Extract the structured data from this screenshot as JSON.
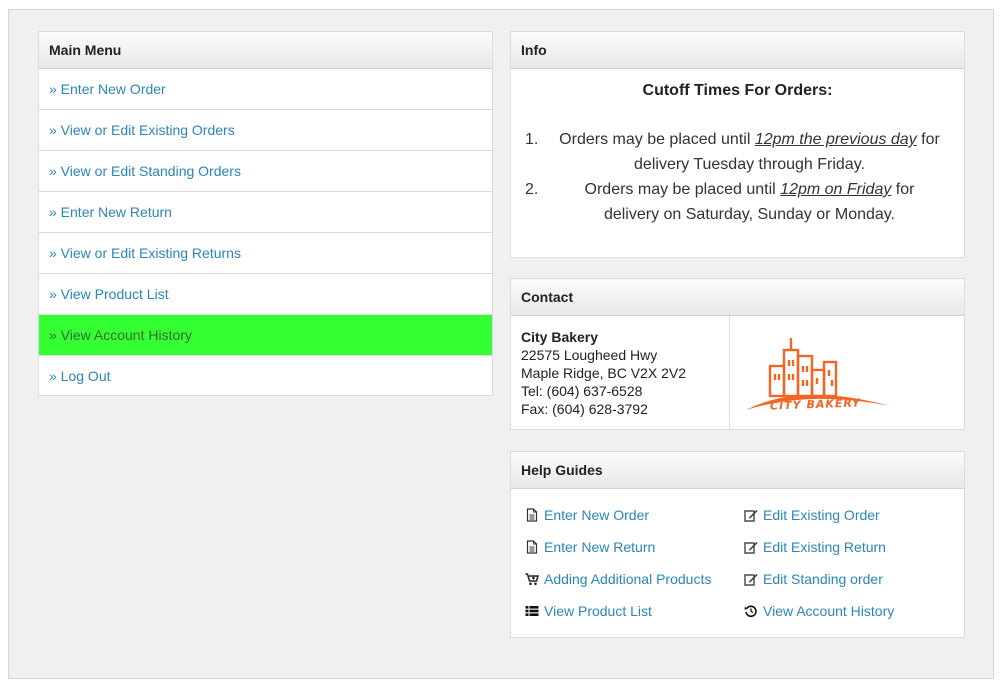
{
  "main_menu": {
    "title": "Main Menu",
    "items": [
      {
        "label": "» Enter New Order"
      },
      {
        "label": "» View or Edit Existing Orders"
      },
      {
        "label": "» View or Edit Standing Orders"
      },
      {
        "label": "» Enter New Return"
      },
      {
        "label": "» View or Edit Existing Returns"
      },
      {
        "label": "» View Product List"
      },
      {
        "label": "» View Account History",
        "active": true
      },
      {
        "label": "» Log Out"
      }
    ],
    "active_color": "#33ff33",
    "link_color": "#2a86b8"
  },
  "info": {
    "title": "Info",
    "heading": "Cutoff Times For Orders:",
    "items": [
      {
        "num": "1.",
        "pre": "Orders may be placed until ",
        "emph": "12pm the previous day",
        "post": " for delivery Tuesday through Friday."
      },
      {
        "num": "2.",
        "pre": "Orders may be placed until ",
        "emph": "12pm on Friday",
        "post": " for delivery on Saturday, Sunday or Monday."
      }
    ]
  },
  "contact": {
    "title": "Contact",
    "business": "City Bakery",
    "address1": "22575 Lougheed Hwy",
    "address2": "Maple Ridge, BC V2X 2V2",
    "tel": "Tel: (604) 637-6528",
    "fax": "Fax: (604) 628-3792",
    "logo_text": "CITY BAKERY",
    "logo_color": "#f26522"
  },
  "help": {
    "title": "Help Guides",
    "links": [
      {
        "label": "Enter New Order",
        "icon": "document-icon"
      },
      {
        "label": "Edit Existing Order",
        "icon": "edit-icon"
      },
      {
        "label": "Enter New Return",
        "icon": "document-icon"
      },
      {
        "label": "Edit Existing Return",
        "icon": "edit-icon"
      },
      {
        "label": "Adding Additional Products",
        "icon": "cart-plus-icon"
      },
      {
        "label": "Edit Standing order",
        "icon": "edit-icon"
      },
      {
        "label": "View Product List",
        "icon": "list-icon"
      },
      {
        "label": "View Account History",
        "icon": "history-icon"
      }
    ]
  }
}
